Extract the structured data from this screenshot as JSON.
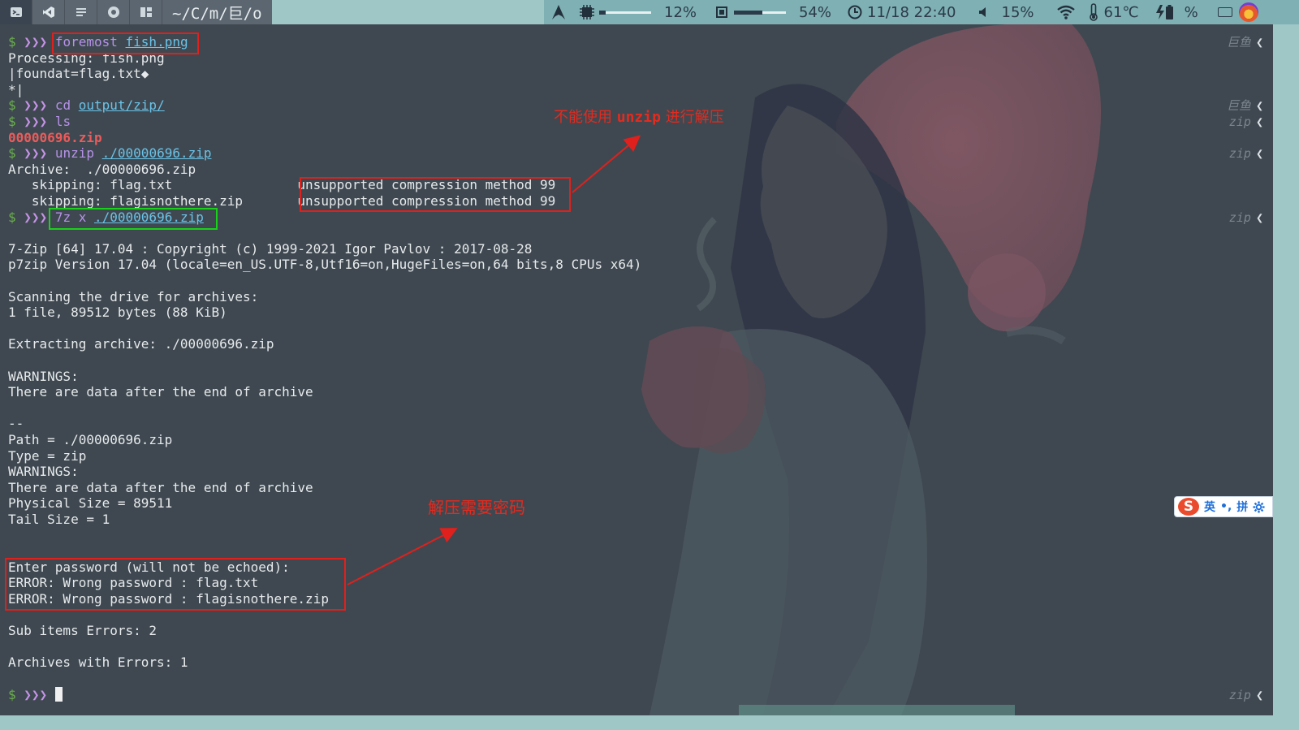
{
  "topbar": {
    "workspaces": [
      {
        "name": "terminal",
        "icon": "terminal-icon"
      },
      {
        "name": "vscode",
        "icon": "vscode-icon"
      },
      {
        "name": "notes",
        "icon": "document-icon"
      },
      {
        "name": "chrome",
        "icon": "chrome-icon"
      },
      {
        "name": "layout",
        "icon": "layout-icon"
      }
    ],
    "path": "~/C/m/巨/o",
    "status": {
      "cpu_value": "12%",
      "cpu_fraction": 0.12,
      "mem_value": "54%",
      "mem_fraction": 0.54,
      "datetime": "11/18 22:40",
      "volume": "15%",
      "temperature": "61℃",
      "battery_unit": "%"
    }
  },
  "terminal": {
    "lines": [
      {
        "type": "prompt",
        "cmd": "foremost",
        "arg": "fish.png"
      },
      {
        "type": "out",
        "text": "Processing: fish.png"
      },
      {
        "type": "out",
        "text": "|foundat=flag.txt◆"
      },
      {
        "type": "out",
        "text": "*|"
      },
      {
        "type": "prompt",
        "cmd": "cd",
        "arg": "output/zip/"
      },
      {
        "type": "prompt",
        "cmd": "ls",
        "arg": ""
      },
      {
        "type": "redfile",
        "text": "00000696.zip"
      },
      {
        "type": "prompt",
        "cmd": "unzip",
        "arg": "./00000696.zip"
      },
      {
        "type": "out",
        "text": "Archive:  ./00000696.zip"
      },
      {
        "type": "out",
        "text": "   skipping: flag.txt                unsupported compression method 99"
      },
      {
        "type": "out",
        "text": "   skipping: flagisnothere.zip       unsupported compression method 99"
      },
      {
        "type": "prompt",
        "cmd": "7z x",
        "arg": "./00000696.zip"
      },
      {
        "type": "out",
        "text": ""
      },
      {
        "type": "out",
        "text": "7-Zip [64] 17.04 : Copyright (c) 1999-2021 Igor Pavlov : 2017-08-28"
      },
      {
        "type": "out",
        "text": "p7zip Version 17.04 (locale=en_US.UTF-8,Utf16=on,HugeFiles=on,64 bits,8 CPUs x64)"
      },
      {
        "type": "out",
        "text": ""
      },
      {
        "type": "out",
        "text": "Scanning the drive for archives:"
      },
      {
        "type": "out",
        "text": "1 file, 89512 bytes (88 KiB)"
      },
      {
        "type": "out",
        "text": ""
      },
      {
        "type": "out",
        "text": "Extracting archive: ./00000696.zip"
      },
      {
        "type": "out",
        "text": ""
      },
      {
        "type": "out",
        "text": "WARNINGS:"
      },
      {
        "type": "out",
        "text": "There are data after the end of archive"
      },
      {
        "type": "out",
        "text": ""
      },
      {
        "type": "out",
        "text": "--"
      },
      {
        "type": "out",
        "text": "Path = ./00000696.zip"
      },
      {
        "type": "out",
        "text": "Type = zip"
      },
      {
        "type": "out",
        "text": "WARNINGS:"
      },
      {
        "type": "out",
        "text": "There are data after the end of archive"
      },
      {
        "type": "out",
        "text": "Physical Size = 89511"
      },
      {
        "type": "out",
        "text": "Tail Size = 1"
      },
      {
        "type": "out",
        "text": ""
      },
      {
        "type": "out",
        "text": ""
      },
      {
        "type": "out",
        "text": "Enter password (will not be echoed):"
      },
      {
        "type": "out",
        "text": "ERROR: Wrong password : flag.txt"
      },
      {
        "type": "out",
        "text": "ERROR: Wrong password : flagisnothere.zip"
      },
      {
        "type": "out",
        "text": ""
      },
      {
        "type": "out",
        "text": "Sub items Errors: 2"
      },
      {
        "type": "out",
        "text": ""
      },
      {
        "type": "out",
        "text": "Archives with Errors: 1"
      },
      {
        "type": "out",
        "text": ""
      },
      {
        "type": "cursor"
      }
    ],
    "prompt_dollar": "$",
    "prompt_arrows": "❯❯❯",
    "right_prompts": [
      {
        "row": 0,
        "text": "巨鱼"
      },
      {
        "row": 4,
        "text": "巨鱼"
      },
      {
        "row": 5,
        "text": "zip"
      },
      {
        "row": 7,
        "text": "zip"
      },
      {
        "row": 11,
        "text": "zip"
      },
      {
        "row": 41,
        "text": "zip"
      }
    ],
    "right_prompt_chevron": "❮"
  },
  "annotations": {
    "unzip_note_prefix": "不能使用 ",
    "unzip_note_code": "unzip",
    "unzip_note_suffix": " 进行解压",
    "password_note": "解压需要密码"
  },
  "ime": {
    "logo": "S",
    "mode": "英",
    "punct": "•,",
    "pinyin": "拼",
    "settings_icon": "gear-icon"
  },
  "colors": {
    "terminal_bg": "#3f4850",
    "bar_bg": "#9ec7c6",
    "annotation_red": "#e0201c",
    "box_green": "#1ad11a"
  }
}
